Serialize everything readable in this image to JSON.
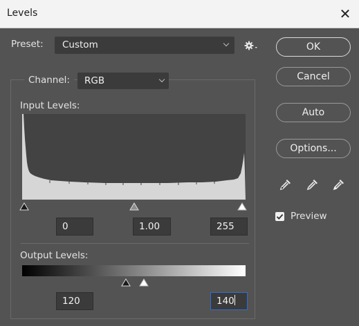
{
  "window": {
    "title": "Levels",
    "close_glyph": "✕"
  },
  "preset": {
    "label": "Preset:",
    "value": "Custom"
  },
  "channel": {
    "label": "Channel:",
    "value": "RGB"
  },
  "input_levels": {
    "label": "Input Levels:",
    "black": "0",
    "gamma": "1.00",
    "white": "255"
  },
  "output_levels": {
    "label": "Output Levels:",
    "black": "120",
    "white": "140"
  },
  "buttons": {
    "ok": "OK",
    "cancel": "Cancel",
    "auto": "Auto",
    "options": "Options..."
  },
  "preview": {
    "label": "Preview",
    "checked": true
  },
  "icons": [
    "gear-icon",
    "black-eyedropper-icon",
    "gray-eyedropper-icon",
    "white-eyedropper-icon"
  ],
  "colors": {
    "dialog_bg": "#535353",
    "field_bg": "#3b3b3b",
    "titlebar_bg": "#f3f3f3",
    "focus_border": "#2f6fd0"
  }
}
